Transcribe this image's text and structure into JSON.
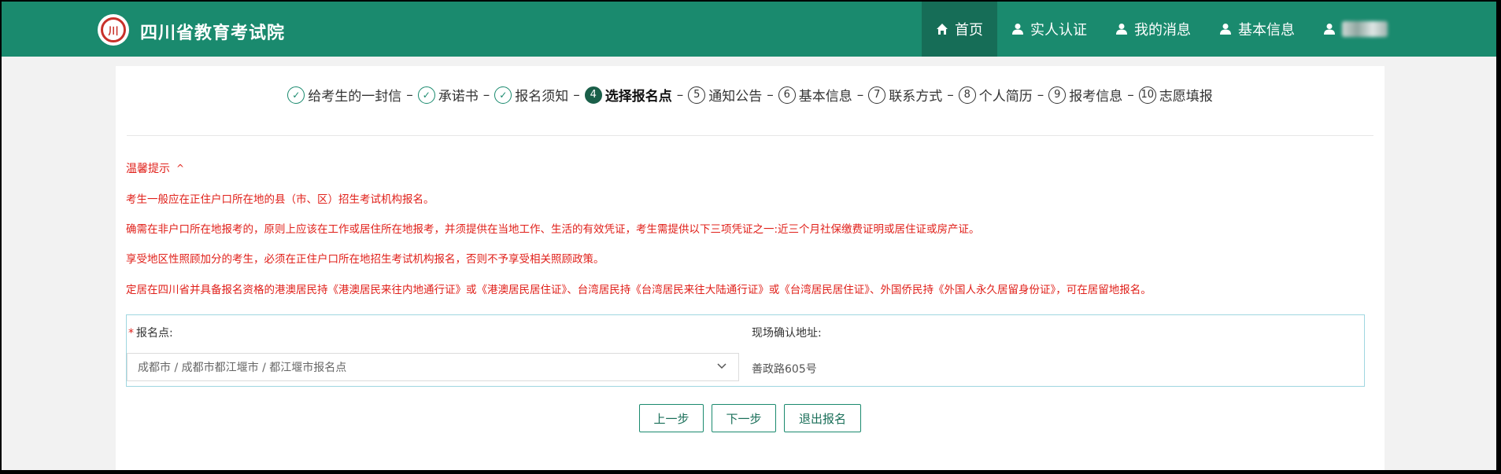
{
  "header": {
    "logo_text": "川",
    "site_title": "四川省教育考试院",
    "nav": [
      {
        "label": "首页",
        "icon": "home-icon"
      },
      {
        "label": "实人认证",
        "icon": "user-icon"
      },
      {
        "label": "我的消息",
        "icon": "user-icon"
      },
      {
        "label": "基本信息",
        "icon": "user-icon"
      },
      {
        "label": "",
        "icon": "user-icon"
      }
    ]
  },
  "steps": [
    {
      "num": "✓",
      "label": "给考生的一封信"
    },
    {
      "num": "✓",
      "label": "承诺书"
    },
    {
      "num": "✓",
      "label": "报名须知"
    },
    {
      "num": "4",
      "label": "选择报名点"
    },
    {
      "num": "5",
      "label": "通知公告"
    },
    {
      "num": "6",
      "label": "基本信息"
    },
    {
      "num": "7",
      "label": "联系方式"
    },
    {
      "num": "8",
      "label": "个人简历"
    },
    {
      "num": "9",
      "label": "报考信息"
    },
    {
      "num": "10",
      "label": "志愿填报"
    }
  ],
  "step_separator": "–",
  "tips": {
    "title": "温馨提示",
    "chevron": "^",
    "lines": [
      "考生一般应在正住户口所在地的县（市、区）招生考试机构报名。",
      "确需在非户口所在地报考的，原则上应该在工作或居住所在地报考，并须提供在当地工作、生活的有效凭证，考生需提供以下三项凭证之一:近三个月社保缴费证明或居住证或房产证。",
      "享受地区性照顾加分的考生，必须在正住户口所在地招生考试机构报名，否则不予享受相关照顾政策。",
      "定居在四川省并具备报名资格的港澳居民持《港澳居民来往内地通行证》或《港澳居民居住证》、台湾居民持《台湾居民来往大陆通行证》或《台湾居民居住证》、外国侨民持《外国人永久居留身份证》，可在居留地报名。"
    ]
  },
  "form": {
    "required_mark": "*",
    "site_label": "报名点:",
    "site_value": "成都市 / 成都市都江堰市 / 都江堰市报名点",
    "address_label": "现场确认地址:",
    "address_value": "善政路605号"
  },
  "buttons": {
    "prev": "上一步",
    "next": "下一步",
    "quit": "退出报名"
  },
  "colors": {
    "header_bg": "#1a8a6e",
    "nav_active_bg": "#166d57",
    "tip_text": "#e0201a",
    "form_border": "#9fd6e0"
  }
}
